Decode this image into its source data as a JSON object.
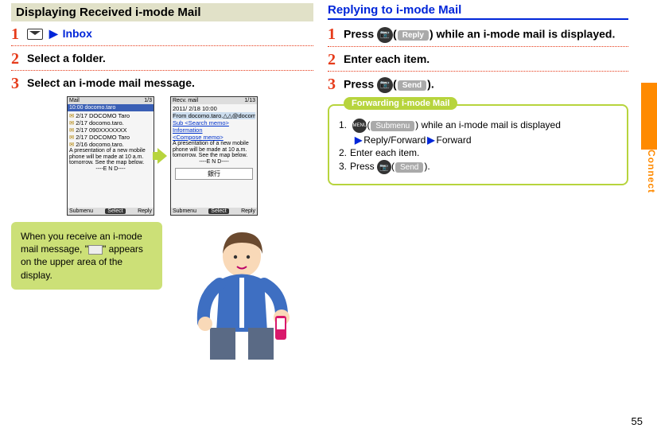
{
  "side_tab": "Connect",
  "page_number": "55",
  "left": {
    "title": "Displaying Received i-mode Mail",
    "steps": {
      "s1": {
        "num": "1",
        "inbox": "Inbox"
      },
      "s2": {
        "num": "2",
        "text": "Select a folder."
      },
      "s3": {
        "num": "3",
        "text": "Select an i-mode mail message."
      }
    },
    "screen1": {
      "top_left": "Mail",
      "top_right": "1/3",
      "title_row": "10:00  docomo.taro",
      "rows": [
        "2/17  DOCOMO Taro",
        "2/17  docomo.taro.",
        "2/17  090XXXXXXX",
        "2/17  DOCOMO Taro",
        "2/16  docomo.taro."
      ],
      "body": "A presentation of a new mobile phone will be made at 10 a.m. tomorrow. See the map below.",
      "end": "----E N D----",
      "soft_left": "Submenu",
      "soft_mid": "Select",
      "soft_right": "Reply"
    },
    "screen2": {
      "top_left": "Recv. mail",
      "top_right": "1/13",
      "date": "2011/ 2/18 10:00",
      "from": "From docomo.taro.△△@docom",
      "sub": "Sub <Search memo>",
      "link1": "Information",
      "link2": "<Compose memo>",
      "body": "A presentation of a new mobile phone will be made at 10 a.m. tomorrow. See the map below.",
      "end": "----E N D----",
      "banner": "銀行",
      "soft_left": "Submenu",
      "soft_mid": "Select",
      "soft_right": "Reply"
    },
    "tip": {
      "pre": "When you receive an i-mode mail message, \"",
      "post": "\" appears on the upper area of the display."
    }
  },
  "right": {
    "title": "Replying to i-mode Mail",
    "steps": {
      "s1": {
        "num": "1",
        "pre": "Press ",
        "btn_icon": "📷",
        "btn_label": "Reply",
        "post": " while an i-mode mail is displayed."
      },
      "s2": {
        "num": "2",
        "text": "Enter each item."
      },
      "s3": {
        "num": "3",
        "pre": "Press ",
        "btn_icon": "📷",
        "btn_label": "Send",
        "post": "."
      }
    },
    "forward": {
      "title": "Forwarding i-mode Mail",
      "l1": {
        "n": "1.",
        "btn_icon": "MENU",
        "btn_label": "Submenu",
        "post": " while an i-mode mail is displayed"
      },
      "l1b": {
        "a": "Reply/Forward",
        "b": "Forward"
      },
      "l2": {
        "n": "2.",
        "text": "Enter each item."
      },
      "l3": {
        "n": "3.",
        "pre": "Press ",
        "btn_icon": "📷",
        "btn_label": "Send",
        "post": "."
      }
    }
  }
}
